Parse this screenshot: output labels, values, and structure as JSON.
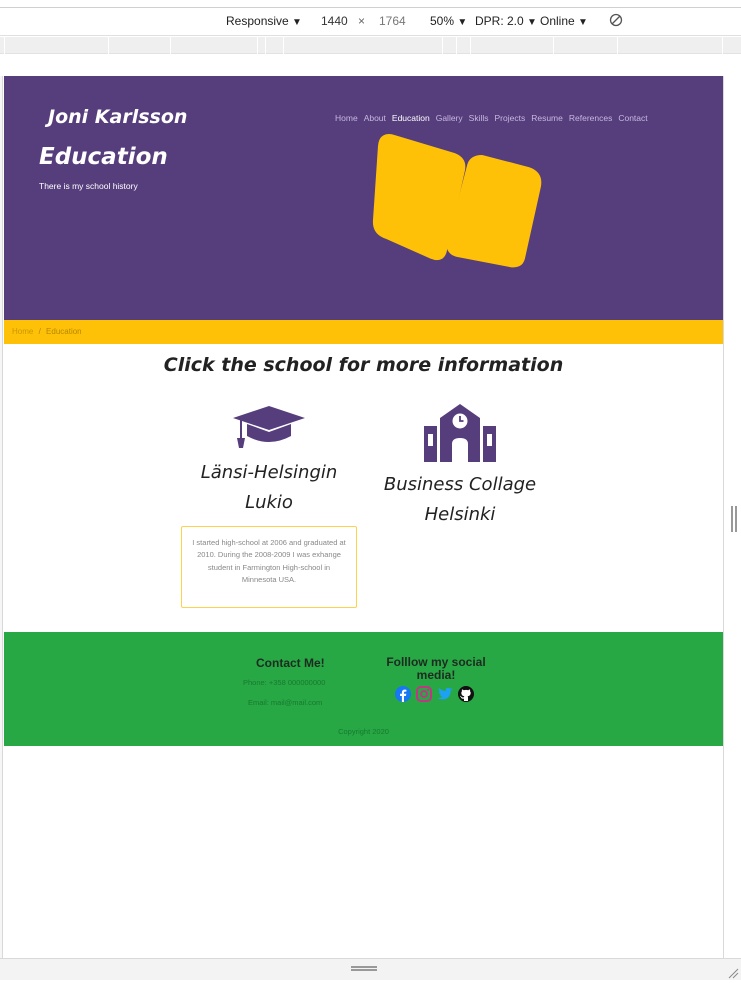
{
  "devtools": {
    "device_mode": "Responsive",
    "width": "1440",
    "times": "×",
    "height": "1764",
    "zoom": "50%",
    "dpr": "DPR: 2.0",
    "throttle": "Online",
    "caret": "▼"
  },
  "site": {
    "brand": "Joni Karlsson",
    "nav": [
      {
        "label": "Home",
        "active": false
      },
      {
        "label": "About",
        "active": false
      },
      {
        "label": "Education",
        "active": true
      },
      {
        "label": "Gallery",
        "active": false
      },
      {
        "label": "Skills",
        "active": false
      },
      {
        "label": "Projects",
        "active": false
      },
      {
        "label": "Resume",
        "active": false
      },
      {
        "label": "References",
        "active": false
      },
      {
        "label": "Contact",
        "active": false
      }
    ],
    "hero_title": "Education",
    "hero_subtitle": "There is my school history",
    "hero_icon": "open-book-icon",
    "breadcrumb": {
      "home": "Home",
      "separator": "/",
      "current": "Education"
    }
  },
  "main": {
    "heading": "Click the school for more information",
    "schools": [
      {
        "icon": "graduation-cap-icon",
        "line1": "Länsi-Helsingin",
        "line2": "Lukio"
      },
      {
        "icon": "school-building-icon",
        "line1": "Business Collage",
        "line2": "Helsinki"
      }
    ],
    "info": "I started high-school at 2006 and graduated at 2010. During the 2008-2009 I was exhange student in Farmington High-school in Minnesota USA."
  },
  "footer": {
    "contact_title": "Contact Me!",
    "phone": "Phone: +358 000000000",
    "email": "Email: mail@mail.com",
    "social_title": "Folllow my social media!",
    "social_icons": [
      "facebook-icon",
      "instagram-icon",
      "twitter-icon",
      "github-icon"
    ],
    "copyright": "Copyright 2020"
  },
  "colors": {
    "primary": "#563d7c",
    "accent": "#ffc107",
    "footer": "#28a745"
  }
}
